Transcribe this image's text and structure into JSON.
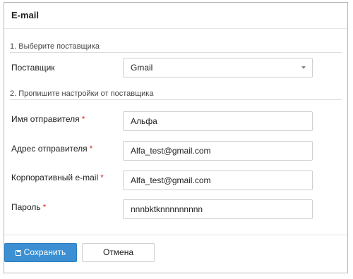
{
  "dialog": {
    "title": "E-mail"
  },
  "sections": {
    "provider_heading": "1. Выберите поставщика",
    "settings_heading": "2. Пропишите настройки от поставщика"
  },
  "fields": {
    "provider": {
      "label": "Поставщик",
      "value": "Gmail"
    },
    "sender_name": {
      "label": "Имя отправителя",
      "required_mark": "*",
      "value": "Альфа"
    },
    "sender_address": {
      "label": "Адрес отправителя",
      "required_mark": "*",
      "value": "Alfa_test@gmail.com"
    },
    "corporate_email": {
      "label": "Корпоративный e-mail",
      "required_mark": "*",
      "value": "Alfa_test@gmail.com"
    },
    "password": {
      "label": "Пароль",
      "required_mark": "*",
      "value": "nnnbktknnnnnnnnn"
    }
  },
  "buttons": {
    "save_label": "Сохранить",
    "cancel_label": "Отмена"
  },
  "icons": {
    "save": "floppy-disk-icon",
    "dropdown": "caret-down-icon"
  },
  "colors": {
    "primary": "#3b8fd2",
    "required": "#d9302c",
    "border": "#cfcfcf"
  }
}
